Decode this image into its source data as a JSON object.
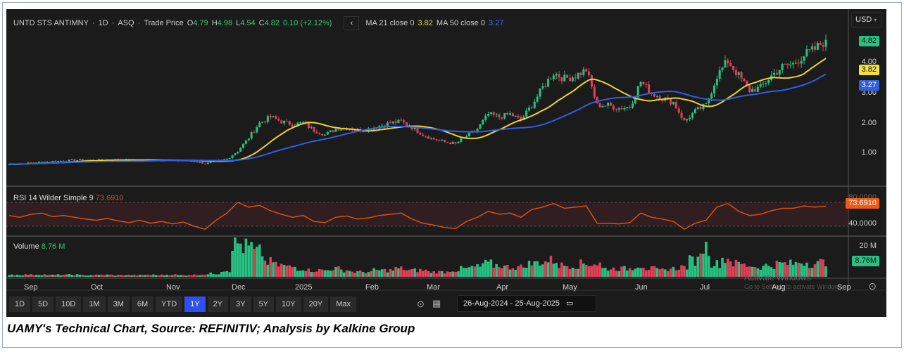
{
  "header": {
    "symbol": "UNTD STS ANTIMNY",
    "interval": "1D",
    "exchange": "ASQ",
    "price_type": "Trade Price",
    "open": "4.79",
    "high": "4.98",
    "low": "4.54",
    "close": "4.82",
    "change": "0.10 (+2.12%)",
    "ma21_label": "MA 21 close 0",
    "ma21_value": "3.82",
    "ma50_label": "MA 50 close 0",
    "ma50_value": "3.27",
    "currency": "USD"
  },
  "price_axis": [
    "4.00",
    "3.00",
    "2.00",
    "1.00"
  ],
  "tags": {
    "last": "4.82",
    "ma21": "3.82",
    "ma50": "3.27",
    "rsi": "73.6910",
    "volume": "8.76M"
  },
  "rsi": {
    "label": "RSI 14 Wilder Simple 9",
    "value": "73.6910",
    "axis": [
      "80.0000",
      "40.0000"
    ]
  },
  "volume": {
    "label": "Volume",
    "value": "8.76 M",
    "axis": "20 M"
  },
  "months": [
    "Sep",
    "Oct",
    "Nov",
    "Dec",
    "2025",
    "Feb",
    "Mar",
    "Apr",
    "May",
    "Jun",
    "Jul",
    "Aug",
    "Sep"
  ],
  "ranges": [
    "1D",
    "5D",
    "10D",
    "1M",
    "3M",
    "6M",
    "YTD",
    "1Y",
    "2Y",
    "3Y",
    "5Y",
    "10Y",
    "20Y",
    "Max"
  ],
  "active_range": "1Y",
  "date_range": "26-Aug-2024 - 25-Aug-2025",
  "watermark": "Activate Windows",
  "watermark_sub": "Go to Settings to activate Windows.",
  "caption": "UAMY's Technical Chart, Source: REFINITIV; Analysis by Kalkine Group",
  "colors": {
    "up": "#26c281",
    "down": "#e0405a",
    "ma21": "#e8d23a",
    "ma50": "#2f5fe0",
    "rsi": "#d2521a",
    "bg": "#1b1b1b"
  },
  "chart_data": {
    "type": "candlestick",
    "x_range": [
      "26-Aug-2024",
      "25-Aug-2025"
    ],
    "ylim": [
      0,
      5
    ],
    "closes": [
      0.6,
      0.62,
      0.65,
      0.68,
      0.7,
      0.72,
      0.74,
      0.75,
      0.74,
      0.76,
      0.75,
      0.74,
      0.73,
      0.75,
      0.74,
      0.72,
      0.73,
      0.7,
      0.62,
      0.7,
      0.78,
      1.05,
      1.5,
      2.0,
      2.2,
      2.05,
      1.95,
      2.0,
      1.75,
      1.6,
      1.8,
      1.85,
      1.75,
      1.8,
      1.9,
      2.0,
      2.05,
      1.85,
      1.6,
      1.45,
      1.35,
      1.3,
      1.55,
      1.8,
      2.3,
      2.2,
      2.3,
      2.1,
      2.6,
      3.2,
      3.7,
      3.5,
      3.6,
      3.8,
      2.6,
      2.6,
      2.5,
      2.55,
      3.4,
      3.0,
      2.85,
      2.7,
      2.05,
      2.4,
      2.6,
      3.6,
      4.1,
      3.6,
      3.1,
      3.2,
      3.6,
      3.9,
      4.0,
      4.3,
      4.5,
      4.82
    ],
    "rsi": [
      58,
      55,
      60,
      62,
      56,
      58,
      55,
      52,
      50,
      53,
      49,
      46,
      50,
      45,
      48,
      44,
      47,
      40,
      35,
      50,
      62,
      80,
      72,
      75,
      66,
      60,
      55,
      58,
      48,
      46,
      55,
      57,
      52,
      54,
      58,
      60,
      62,
      52,
      45,
      42,
      38,
      36,
      48,
      55,
      65,
      60,
      62,
      55,
      68,
      72,
      78,
      70,
      72,
      74,
      45,
      45,
      44,
      46,
      62,
      55,
      52,
      48,
      35,
      45,
      50,
      72,
      78,
      65,
      58,
      60,
      66,
      70,
      70,
      74,
      72,
      73.69
    ],
    "volume_m": [
      1.5,
      1.2,
      1.3,
      1.4,
      1.1,
      1.2,
      1.3,
      1.0,
      1.1,
      1.2,
      1.0,
      1.1,
      1.0,
      1.2,
      1.1,
      1.3,
      1.0,
      1.2,
      1.5,
      2,
      4,
      20,
      18,
      15,
      9,
      7,
      6,
      5,
      4,
      4,
      5,
      4,
      3,
      3,
      4,
      4,
      5,
      4,
      4,
      3,
      3,
      4,
      5,
      6,
      8,
      7,
      6,
      6,
      8,
      9,
      10,
      7,
      7,
      8,
      8,
      5,
      5,
      5,
      7,
      5,
      4,
      5,
      6,
      10,
      18,
      8,
      11,
      8,
      7,
      6,
      7,
      8,
      8,
      9,
      8,
      8.76
    ]
  }
}
